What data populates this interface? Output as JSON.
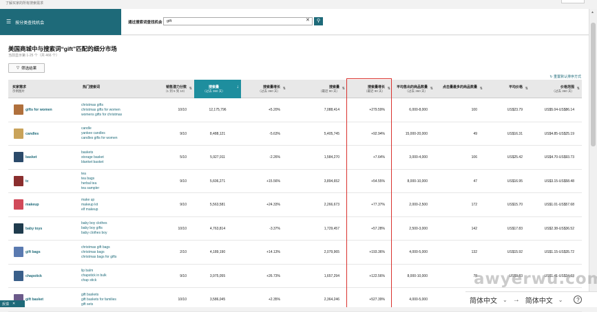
{
  "top": {
    "hint": "了解买家的所有搜索需求"
  },
  "header": {
    "left_label": "按分类查找机会",
    "search_label": "通过搜索词查找机会",
    "search_value": "gift",
    "clear_icon": "close-icon",
    "search_icon": "search-icon"
  },
  "page": {
    "title": "美国商城中与搜索词“gift”匹配的细分市场",
    "subtitle": "当前显示第 1-25 个（共 466 个）",
    "filter_label": "筛选结果",
    "reset_label": "重置默认排序方式"
  },
  "columns": [
    {
      "label": "买家需求",
      "sub": "示例图片"
    },
    {
      "label": "热门搜索词",
      "sub": ""
    },
    {
      "label": "销售潜力分数",
      "sub": "（1 到 5 到 10）",
      "arrow": "⇅"
    },
    {
      "label": "搜索量",
      "sub": "（过去 360 天）",
      "arrow": "↓"
    },
    {
      "label": "搜索量增长",
      "sub": "（过去 360 天）",
      "arrow": "⇅"
    },
    {
      "label": "搜索量",
      "sub": "（最近 90 天）",
      "arrow": "⇅"
    },
    {
      "label": "搜索量增长",
      "sub": "（最近 90 天）",
      "arrow": "⇅"
    },
    {
      "label": "平均售出的商品数量",
      "sub": "（过去 360 天）",
      "arrow": "⇅"
    },
    {
      "label": "点击量最多的商品数量",
      "sub": "",
      "arrow": "⇅"
    },
    {
      "label": "平均价格",
      "sub": "",
      "arrow": "⇅"
    },
    {
      "label": "价格范围",
      "sub": "（过去 360 天）",
      "arrow": "⇅"
    }
  ],
  "rows": [
    {
      "niche": "gifts for women",
      "terms": [
        "christmas gifts",
        "christmas gifts for women",
        "womens gifts for christmas"
      ],
      "score": "10/10",
      "vol360": "12,175,796",
      "g360": "+5.20%",
      "vol90": "7,088,414",
      "g90": "+279.59%",
      "units": "6,000-8,000",
      "clicked": "100",
      "avg_price": "US$23.79",
      "range": "US$5.04-US$86.14",
      "thumb_color": "#b0703c"
    },
    {
      "niche": "candles",
      "terms": [
        "candle",
        "yankee candles",
        "candles gifts for women"
      ],
      "score": "9/10",
      "vol360": "8,488,121",
      "g360": "-5.63%",
      "vol90": "5,405,745",
      "g90": "+92.94%",
      "units": "15,000-20,000",
      "clicked": "49",
      "avg_price": "US$16.31",
      "range": "US$4.85-US$25.19",
      "thumb_color": "#c9a35a"
    },
    {
      "niche": "basket",
      "terms": [
        "baskets",
        "storage basket",
        "blanket basket"
      ],
      "score": "5/10",
      "vol360": "5,927,911",
      "g360": "-2.26%",
      "vol90": "1,584,270",
      "g90": "+7.64%",
      "units": "3,000-4,000",
      "clicked": "106",
      "avg_price": "US$25.42",
      "range": "US$4.70-US$93.73",
      "thumb_color": "#2b4a6a"
    },
    {
      "niche": "tc",
      "terms": [
        "tea",
        "tea bags",
        "herbal tea",
        "tea sampler"
      ],
      "score": "9/10",
      "vol360": "5,606,271",
      "g360": "+15.56%",
      "vol90": "3,894,652",
      "g90": "+54.55%",
      "units": "8,000-10,000",
      "clicked": "47",
      "avg_price": "US$16.95",
      "range": "US$3.15-US$58.48",
      "thumb_color": "#8a2e2e"
    },
    {
      "niche": "makeup",
      "terms": [
        "make up",
        "makeup kit",
        "elf makeup"
      ],
      "score": "9/10",
      "vol360": "5,563,581",
      "g360": "+24.33%",
      "vol90": "2,266,673",
      "g90": "+77.37%",
      "units": "2,000-2,500",
      "clicked": "172",
      "avg_price": "US$15.70",
      "range": "US$1.01-US$57.68",
      "thumb_color": "#d14a5a"
    },
    {
      "niche": "baby toys",
      "terms": [
        "baby boy clothes",
        "baby boy gifts",
        "baby clothes boy"
      ],
      "score": "10/10",
      "vol360": "4,763,814",
      "g360": "-3.37%",
      "vol90": "1,729,457",
      "g90": "+57.28%",
      "units": "2,500-3,000",
      "clicked": "142",
      "avg_price": "US$17.83",
      "range": "US$2.38-US$36.52",
      "thumb_color": "#1f3b4d"
    },
    {
      "niche": "gift bags",
      "terms": [
        "christmas gift bags",
        "christmas bags",
        "christmas bags for gifts"
      ],
      "score": "2/10",
      "vol360": "4,189,190",
      "g360": "+14.13%",
      "vol90": "2,079,965",
      "g90": "+193.36%",
      "units": "4,000-5,000",
      "clicked": "132",
      "avg_price": "US$15.92",
      "range": "US$1.15-US$35.72",
      "thumb_color": "#5a7ab0"
    },
    {
      "niche": "chapstick",
      "terms": [
        "lip balm",
        "chapstick in bulk",
        "chap stick"
      ],
      "score": "9/10",
      "vol360": "3,975,055",
      "g360": "+26.73%",
      "vol90": "1,657,294",
      "g90": "+122.56%",
      "units": "8,000-10,000",
      "clicked": "78",
      "avg_price": "US$9.83",
      "range": "US$1.41-US$34.63",
      "thumb_color": "#3a5f8a"
    },
    {
      "niche": "gift basket",
      "terms": [
        "gift baskets",
        "gift baskets for families",
        "gift sets"
      ],
      "score": "10/10",
      "vol360": "3,586,045",
      "g360": "+2.35%",
      "vol90": "2,364,246",
      "g90": "+527.39%",
      "units": "4,000-5,000",
      "clicked": "",
      "avg_price": "",
      "range": "",
      "thumb_color": "#6b5a8a"
    }
  ],
  "footer": {
    "feedback_label": "反馈"
  },
  "watermark": "awyerwu.com",
  "langbar": {
    "from": "简体中文",
    "to": "简体中文",
    "help": "?"
  },
  "colors": {
    "accent": "#1e6a79",
    "highlight": "#1e8e9e",
    "red_box": "#d9302c"
  }
}
